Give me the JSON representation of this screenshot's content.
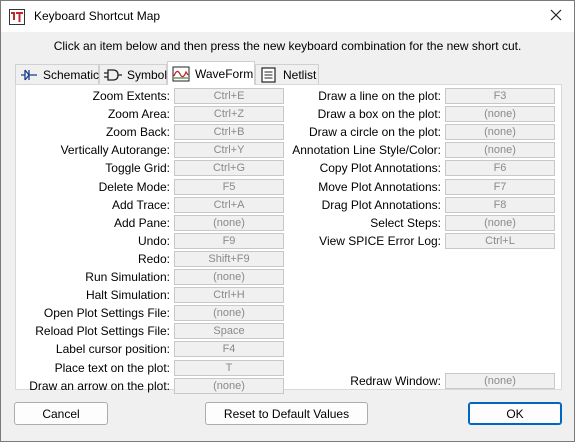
{
  "window": {
    "title": "Keyboard Shortcut Map",
    "instruction": "Click an item below and then press the new keyboard combination for the new short cut."
  },
  "tabs": [
    {
      "label": "Schematic",
      "icon": "schematic-icon",
      "active": false
    },
    {
      "label": "Symbol",
      "icon": "symbol-icon",
      "active": false
    },
    {
      "label": "WaveForm",
      "icon": "waveform-icon",
      "active": true
    },
    {
      "label": "Netlist",
      "icon": "netlist-icon",
      "active": false
    }
  ],
  "left_shortcuts": [
    {
      "label": "Zoom Extents:",
      "key": "Ctrl+E"
    },
    {
      "label": "Zoom Area:",
      "key": "Ctrl+Z"
    },
    {
      "label": "Zoom Back:",
      "key": "Ctrl+B"
    },
    {
      "label": "Vertically Autorange:",
      "key": "Ctrl+Y"
    },
    {
      "label": "Toggle Grid:",
      "key": "Ctrl+G"
    },
    {
      "label": "Delete Mode:",
      "key": "F5"
    },
    {
      "label": "Add Trace:",
      "key": "Ctrl+A"
    },
    {
      "label": "Add Pane:",
      "key": "(none)"
    },
    {
      "label": "Undo:",
      "key": "F9"
    },
    {
      "label": "Redo:",
      "key": "Shift+F9"
    },
    {
      "label": "Run Simulation:",
      "key": "(none)"
    },
    {
      "label": "Halt Simulation:",
      "key": "Ctrl+H"
    },
    {
      "label": "Open Plot Settings File:",
      "key": "(none)"
    },
    {
      "label": "Reload Plot Settings File:",
      "key": "Space"
    },
    {
      "label": "Label cursor position:",
      "key": "F4"
    },
    {
      "label": "Place text on the plot:",
      "key": "T"
    },
    {
      "label": "Draw an arrow on the plot:",
      "key": "(none)"
    }
  ],
  "right_shortcuts": [
    {
      "label": "Draw a line on the plot:",
      "key": "F3"
    },
    {
      "label": "Draw a box on the plot:",
      "key": "(none)"
    },
    {
      "label": "Draw a circle on the plot:",
      "key": "(none)"
    },
    {
      "label": "Annotation Line Style/Color:",
      "key": "(none)"
    },
    {
      "label": "Copy Plot Annotations:",
      "key": "F6"
    },
    {
      "label": "Move Plot Annotations:",
      "key": "F7"
    },
    {
      "label": "Drag Plot Annotations:",
      "key": "F8"
    },
    {
      "label": "Select Steps:",
      "key": "(none)"
    },
    {
      "label": "View SPICE Error Log:",
      "key": "Ctrl+L"
    }
  ],
  "redraw": {
    "label": "Redraw Window:",
    "key": "(none)"
  },
  "buttons": {
    "cancel": "Cancel",
    "reset": "Reset to Default Values",
    "ok": "OK"
  },
  "colors": {
    "accent": "#0067c0",
    "app_icon_red": "#c0282d"
  }
}
